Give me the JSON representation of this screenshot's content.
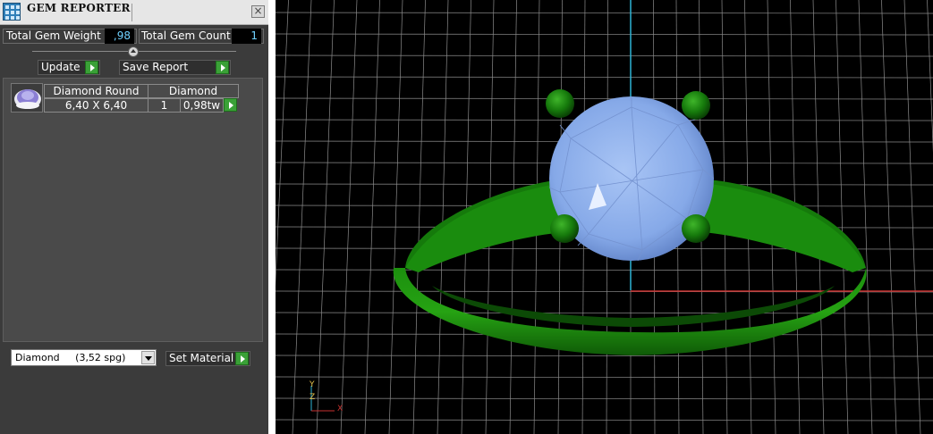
{
  "window": {
    "title": "GEM REPORTER",
    "close_glyph": "×"
  },
  "summary": {
    "total_weight_label": "Total Gem Weight",
    "total_weight_value": ",98",
    "total_count_label": "Total Gem Count",
    "total_count_value": "1"
  },
  "actions": {
    "update_label": "Update",
    "save_report_label": "Save Report"
  },
  "gems": [
    {
      "icon": "round-diamond-icon",
      "shape_header": "Diamond Round",
      "material_header": "Diamond",
      "size": "6,40 X 6,40",
      "count": "1",
      "weight": "0,98tw"
    }
  ],
  "material": {
    "selected": "Diamond     (3,52 spg)",
    "set_label": "Set Material"
  },
  "viewport": {
    "axis_labels": {
      "z": "Z",
      "y": "Y",
      "x": "X"
    },
    "colors": {
      "grid": "#8c8c8c",
      "metal": "#1f8a12",
      "gem": "#8fb1ec",
      "x_axis": "#c8312f",
      "y_axis": "#2eb4d6"
    }
  }
}
